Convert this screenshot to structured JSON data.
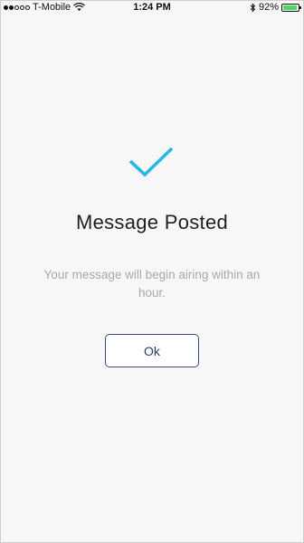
{
  "status_bar": {
    "carrier": "T-Mobile",
    "time": "1:24 PM",
    "battery_percent": "92%",
    "battery_level": 0.92,
    "signal_bars_filled": 2,
    "signal_bars_total": 5
  },
  "dialog": {
    "icon": "checkmark-icon",
    "title": "Message Posted",
    "message": "Your message will begin airing within an hour.",
    "ok_label": "Ok"
  },
  "colors": {
    "accent": "#29b6e8",
    "button_border": "#3a4d80",
    "battery": "#4cd964"
  }
}
